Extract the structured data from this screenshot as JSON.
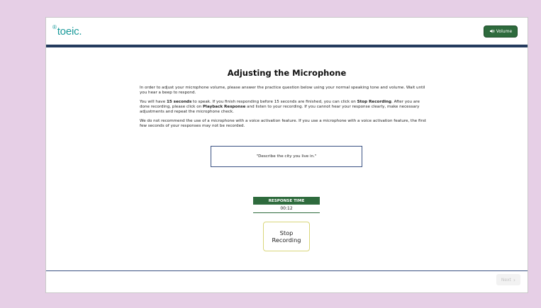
{
  "header": {
    "logo_mark": "®",
    "logo_text": "toeic",
    "logo_dot": ".",
    "volume_label": "Volume",
    "volume_icon": "speaker-icon",
    "accent_color": "#2e6b3d",
    "bar_color": "#243b5e"
  },
  "main": {
    "title": "Adjusting the Microphone",
    "p1": "In order to adjust your microphone volume, please answer the practice question below using your normal speaking tone and volume. Wait until you hear a beep to respond.",
    "p2_a": "You will have ",
    "p2_b": "15 seconds",
    "p2_c": " to speak. If you finish responding before 15 seconds are finished, you can click on ",
    "p2_d": "Stop Recording",
    "p2_e": ". After you are done recording, please click on ",
    "p2_f": "Playback Response",
    "p2_g": " and listen to your recording. If you cannot hear your response clearly, make necessary adjustments and repeat the microphone check.",
    "p3": "We do not recommend the use of a microphone with a voice activation feature. If you use a microphone with a voice activation feature, the first few seconds of your responses may not be recorded.",
    "question": "\"Describe the city you live in.\"",
    "response_time_label": "RESPONSE TIME",
    "response_time_value": "00:12",
    "stop_button_label": "Stop\nRecording"
  },
  "footer": {
    "next_label": "Next",
    "next_icon": "chevron-right-icon"
  }
}
